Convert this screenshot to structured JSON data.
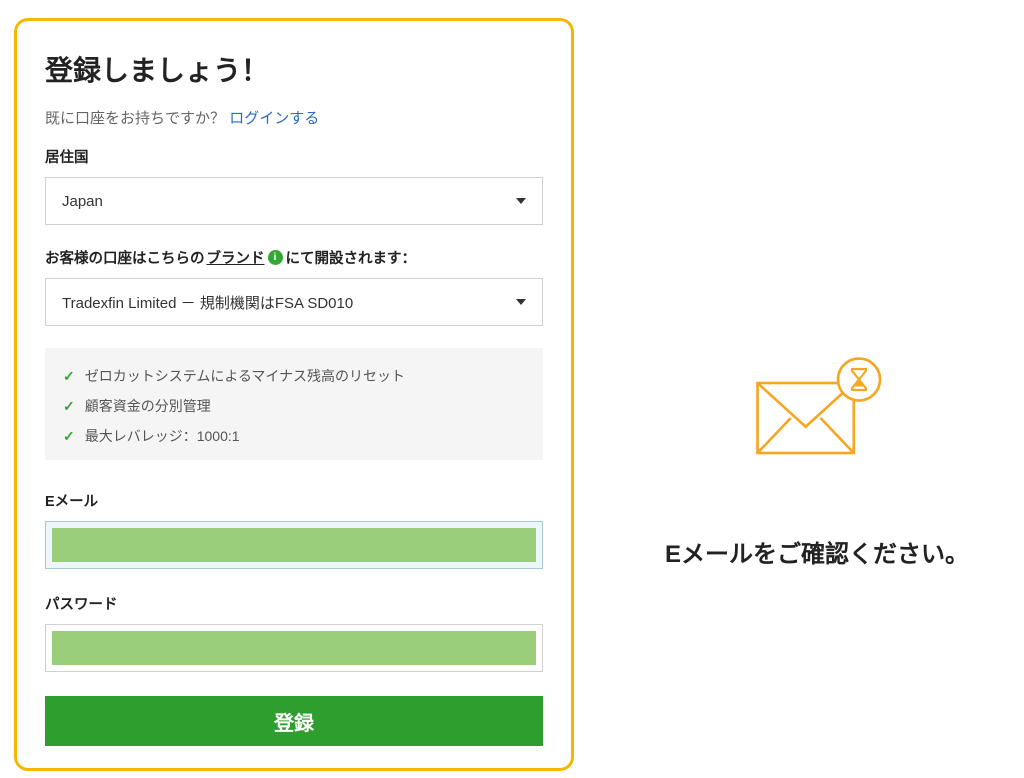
{
  "form": {
    "title": "登録しましょう！",
    "already_text": "既に口座をお持ちですか？",
    "login_link": "ログインする",
    "country_label": "居住国",
    "country_value": "Japan",
    "brand_label_part1": "お客様の口座はこちらの",
    "brand_label_underline": "ブランド",
    "brand_label_part2": "にて開設されます：",
    "brand_value": "Tradexfin Limited － 規制機関はFSA SD010",
    "features": [
      "ゼロカットシステムによるマイナス残高のリセット",
      "顧客資金の分別管理",
      "最大レバレッジ：1000:1"
    ],
    "email_label": "Eメール",
    "password_label": "パスワード",
    "submit_label": "登録"
  },
  "right": {
    "check_email": "Eメールをご確認ください。"
  },
  "colors": {
    "accent_yellow": "#f5b800",
    "accent_green": "#2e9e2e",
    "accent_orange": "#f5a623"
  }
}
